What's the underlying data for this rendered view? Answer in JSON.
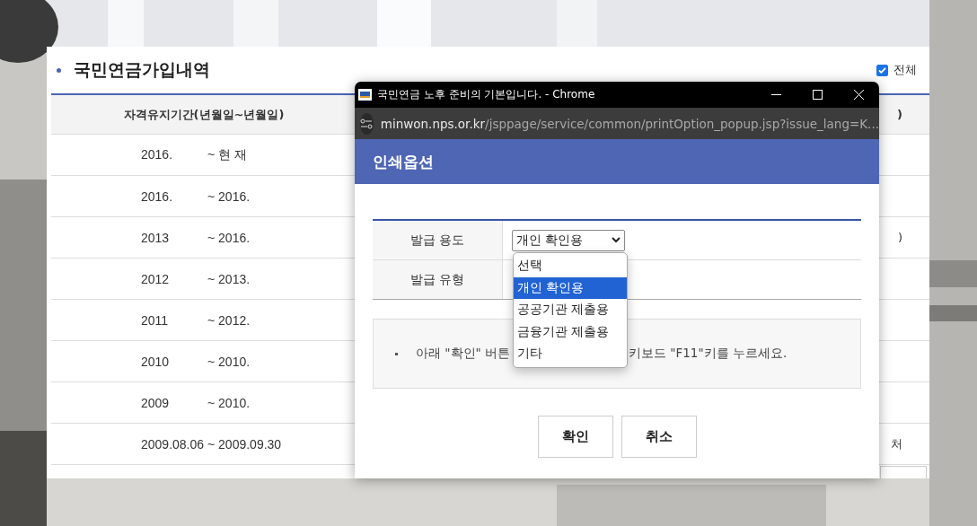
{
  "page": {
    "title": "국민연금가입내역",
    "select_all": {
      "label": "전체",
      "checked": true
    },
    "table": {
      "columns": [
        "자격유지기간(년월일~년월일)",
        ")"
      ],
      "rows": [
        {
          "start": "2016.",
          "end": "~ 현 재"
        },
        {
          "start": "2016.",
          "end": "~ 2016."
        },
        {
          "start": "2013",
          "end": "~ 2016.",
          "column_2": ")"
        },
        {
          "start": "2012",
          "end": "~ 2013."
        },
        {
          "start": "2011",
          "end": "~ 2012."
        },
        {
          "start": "2010",
          "end": "~ 2010."
        },
        {
          "start": "2009",
          "end": "~ 2010."
        },
        {
          "start": "2009.08.06",
          "end": "~ 2009.09.30",
          "column_2": "처"
        }
      ]
    }
  },
  "popup": {
    "title": "국민연금 노후 준비의 기본입니다. - Chrome",
    "url_host": "minwon.nps.or.kr",
    "url_path": "/jsppage/service/common/printOption_popup.jsp?issue_lang=K...",
    "heading": "인쇄옵션",
    "form": [
      {
        "label": "발급 용도",
        "kind": "select",
        "value": "개인 확인용"
      },
      {
        "label": "발급 유형",
        "kind": "empty"
      }
    ],
    "dropdown_options": [
      {
        "label": "선택",
        "selected": false
      },
      {
        "label": "개인 확인용",
        "selected": true
      },
      {
        "label": "공공기관 제출용",
        "selected": false
      },
      {
        "label": "금융기관 제출용",
        "selected": false
      },
      {
        "label": "기타",
        "selected": false
      }
    ],
    "notice_start": "아래 \"확인\" 버튼",
    "notice_end": "키보드 \"F11\"키를 누르세요.",
    "buttons": [
      "확인",
      "취소"
    ]
  }
}
